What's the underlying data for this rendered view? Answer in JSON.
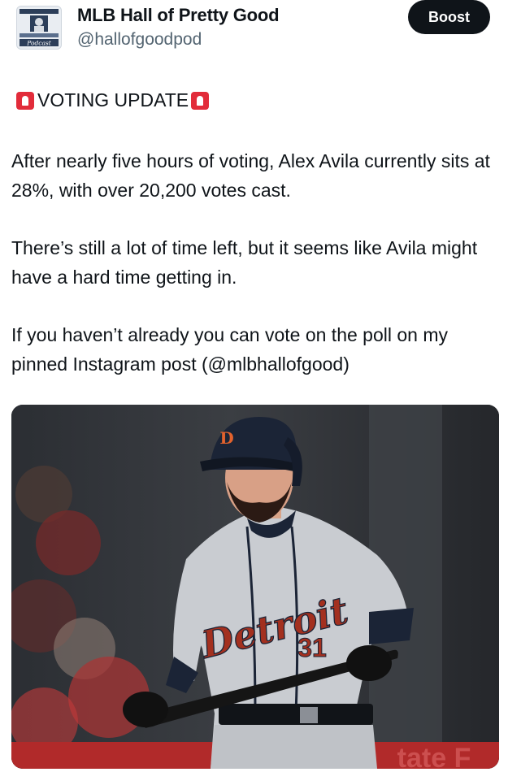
{
  "account": {
    "display_name": "MLB Hall of Pretty Good",
    "handle": "@hallofgoodpod",
    "avatar_text": "Podcast"
  },
  "header": {
    "boost_label": "Boost"
  },
  "post": {
    "headline": "VOTING UPDATE",
    "paragraph_1": "After nearly five hours of voting, Alex Avila currently sits at 28%, with over 20,200 votes cast.",
    "paragraph_2": "There’s still a lot of time left, but it seems like Avila might have a hard time getting in.",
    "paragraph_3": "If you haven’t already you can vote on the poll on my pinned Instagram post (@mlbhallofgood)",
    "icons": [
      "siren-icon",
      "siren-icon"
    ]
  },
  "photo": {
    "jersey_script": "Detroit",
    "jersey_number": "31",
    "colors": {
      "jersey": "#c9ccd1",
      "navy": "#1b2436",
      "orange": "#e2622d",
      "script": "#a3301f"
    }
  }
}
